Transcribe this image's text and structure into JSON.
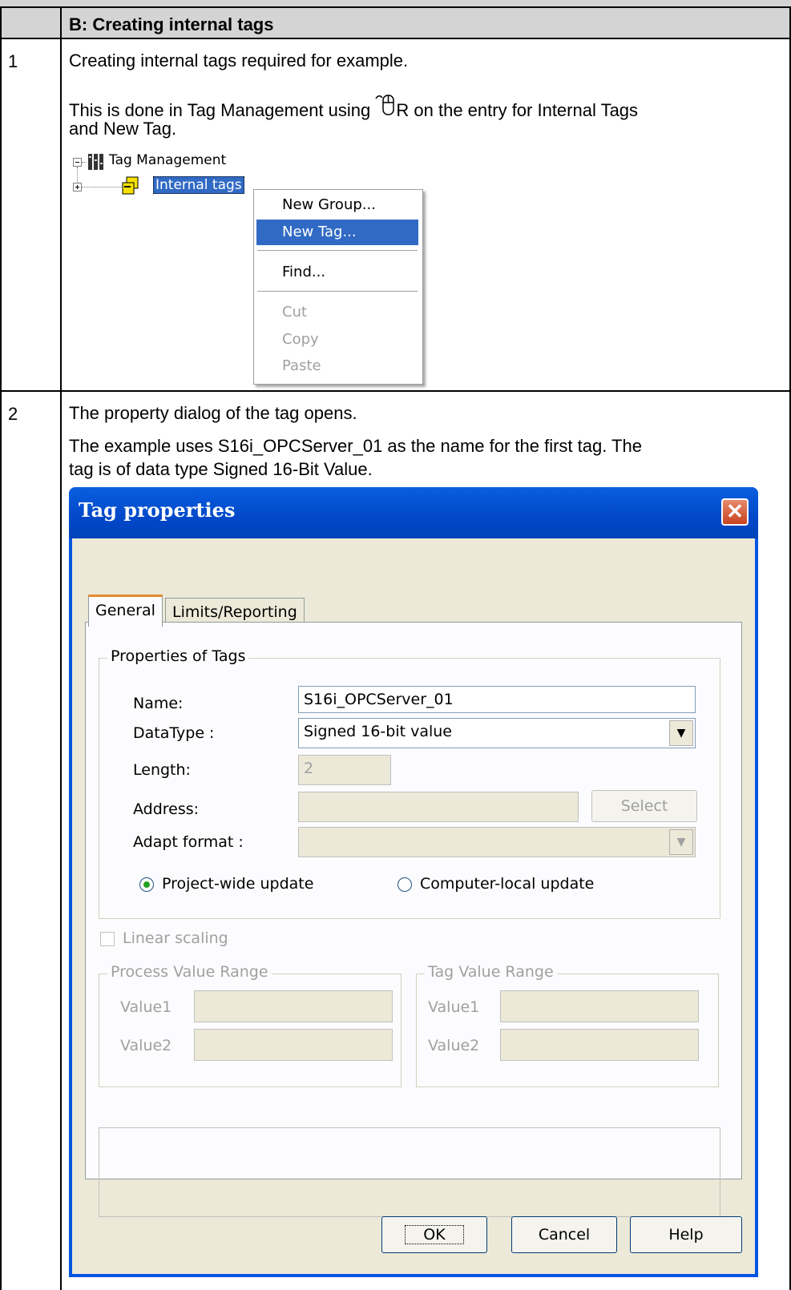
{
  "header": {
    "title": "B: Creating internal tags"
  },
  "rows": [
    {
      "num": "1",
      "p1": "Creating internal tags required for example.",
      "p2a": "This is done in Tag Management using ",
      "p2b": "R on the entry for Internal Tags",
      "p2c": "and New Tag."
    },
    {
      "num": "2",
      "p1": "The property dialog of the tag opens.",
      "p2a": "The example uses S16i_OPCServer_01 as the name for the first tag. The",
      "p2b": "tag is of data type Signed 16-Bit Value."
    }
  ],
  "tree": {
    "root": "Tag Management",
    "child": "Internal tags"
  },
  "context_menu": {
    "items": [
      {
        "label": "New Group...",
        "state": "normal"
      },
      {
        "label": "New Tag...",
        "state": "selected"
      },
      {
        "label": "Find...",
        "state": "normal"
      },
      {
        "label": "Cut",
        "state": "disabled"
      },
      {
        "label": "Copy",
        "state": "disabled"
      },
      {
        "label": "Paste",
        "state": "disabled"
      }
    ]
  },
  "dialog": {
    "title": "Tag properties",
    "tabs": [
      "General",
      "Limits/Reporting"
    ],
    "group_title": "Properties of Tags",
    "name_label": "Name:",
    "name_value": "S16i_OPCServer_01",
    "datatype_label": "DataType :",
    "datatype_value": "Signed 16-bit value",
    "length_label": "Length:",
    "length_value": "2",
    "address_label": "Address:",
    "select_label": "Select",
    "adapt_label": "Adapt format :",
    "radio_project": "Project-wide update",
    "radio_computer": "Computer-local update",
    "linear_scaling": "Linear scaling",
    "process_range": "Process Value Range",
    "tag_range": "Tag Value Range",
    "value1": "Value1",
    "value2": "Value2",
    "ok": "OK",
    "cancel": "Cancel",
    "help": "Help"
  }
}
